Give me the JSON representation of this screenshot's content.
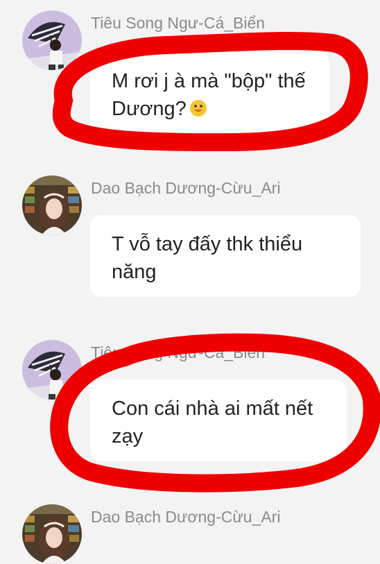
{
  "messages": [
    {
      "sender": "Tiêu Song Ngư-Cá_Biển",
      "lines": [
        "M rơi j à mà \"bộp\" thế",
        "Dương?"
      ],
      "emoji": "smiling-face-emoji",
      "avatar": "boy-umbrella-avatar"
    },
    {
      "sender": "Dao Bạch Dương-Cừu_Ari",
      "lines": [
        "T vỗ tay đấy thk thiểu",
        "năng"
      ],
      "avatar": "girl-headband-avatar"
    },
    {
      "sender": "Tiêu Song Ngư-Cá_Biển",
      "lines": [
        "Con cái nhà ai mất nết",
        "zạy"
      ],
      "avatar": "boy-umbrella-avatar"
    },
    {
      "sender": "Dao Bạch Dương-Cừu_Ari",
      "avatar": "girl-headband-avatar"
    }
  ],
  "colors": {
    "background": "#f3f3f4",
    "bubble": "#ffffff",
    "annotation": "#ee0000",
    "sender_text": "#8a8a8a"
  }
}
